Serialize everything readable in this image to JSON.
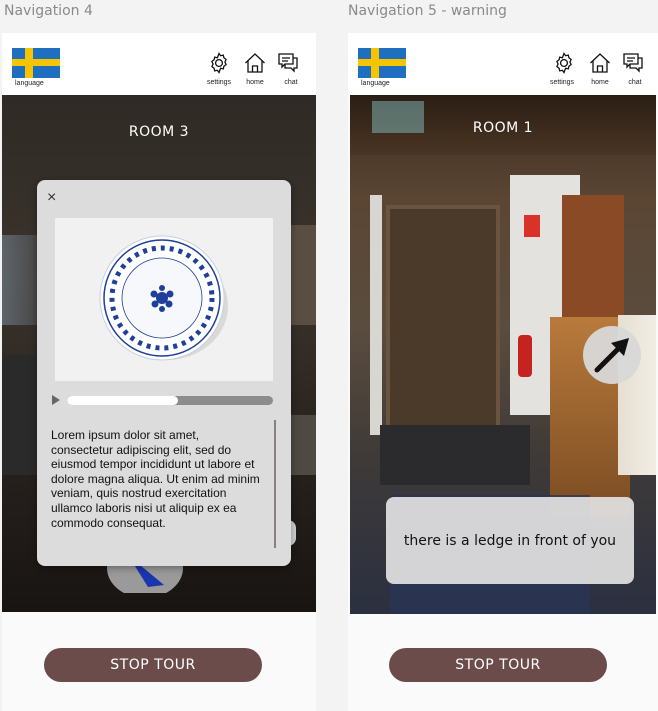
{
  "frames": [
    {
      "title": "Navigation 4",
      "header": {
        "language_label": "language",
        "settings_label": "settings",
        "home_label": "home",
        "chat_label": "chat"
      },
      "room_title": "ROOM 3",
      "modal": {
        "close_label": "×",
        "audio_progress": 0.54,
        "description": "Lorem ipsum dolor sit amet, consectetur adipiscing elit, sed do eiusmod tempor incididunt ut labore et dolore magna aliqua. Ut enim ad minim veniam, quis nostrud exercitation ullamco laboris nisi ut aliquip ex ea commodo consequat."
      },
      "stop_button": "STOP TOUR"
    },
    {
      "title": "Navigation 5 - warning",
      "header": {
        "language_label": "language",
        "settings_label": "settings",
        "home_label": "home",
        "chat_label": "chat"
      },
      "room_title": "ROOM 1",
      "warning": "there is a ledge in front of you",
      "stop_button": "STOP TOUR"
    }
  ],
  "icons": [
    "flag-sweden-icon",
    "settings-gear-icon",
    "home-icon",
    "chat-icon",
    "close-icon",
    "play-icon",
    "arrow-up-right-icon"
  ],
  "colors": {
    "stop_button": "#6b4c4a",
    "flag_blue": "#1f6fc0",
    "flag_yellow": "#f6c400",
    "modal_bg": "#dcdcdc",
    "plate_blue": "#1e3f9a"
  }
}
